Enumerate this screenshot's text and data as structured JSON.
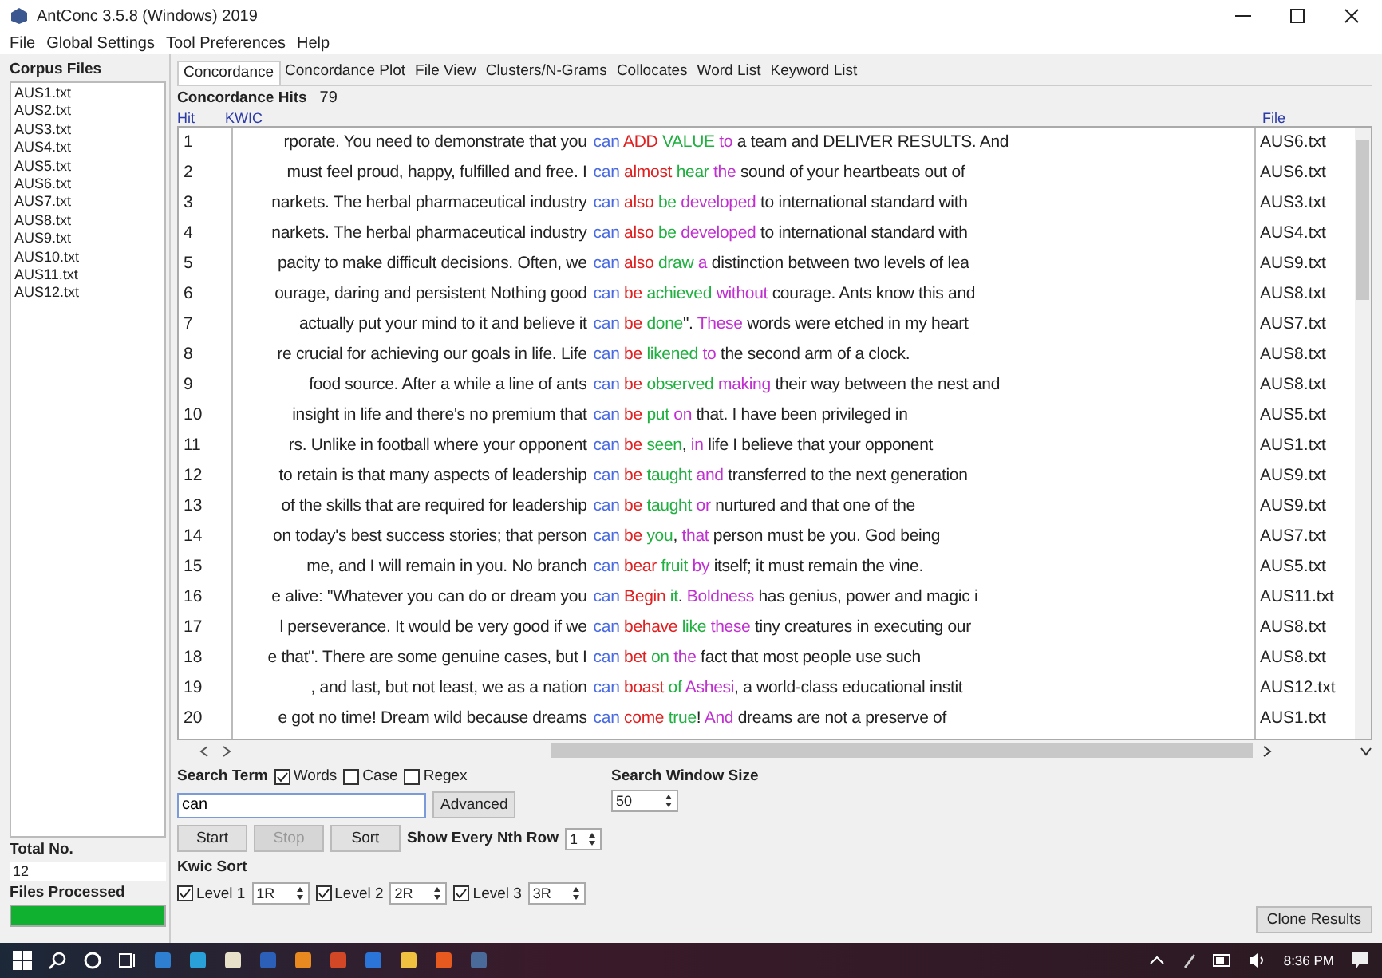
{
  "window": {
    "title": "AntConc 3.5.8 (Windows) 2019"
  },
  "menu": [
    "File",
    "Global Settings",
    "Tool Preferences",
    "Help"
  ],
  "sidebar": {
    "heading": "Corpus Files",
    "files": [
      "AUS1.txt",
      "AUS2.txt",
      "AUS3.txt",
      "AUS4.txt",
      "AUS5.txt",
      "AUS6.txt",
      "AUS7.txt",
      "AUS8.txt",
      "AUS9.txt",
      "AUS10.txt",
      "AUS11.txt",
      "AUS12.txt"
    ],
    "total_label": "Total No.",
    "total": "12",
    "processed_label": "Files Processed",
    "progress": {
      "level": 1
    }
  },
  "tabs": [
    {
      "label": "Concordance",
      "selected": true
    },
    {
      "label": "Concordance Plot",
      "selected": false
    },
    {
      "label": "File View",
      "selected": false
    },
    {
      "label": "Clusters/N-Grams",
      "selected": false
    },
    {
      "label": "Collocates",
      "selected": false
    },
    {
      "label": "Word List",
      "selected": false
    },
    {
      "label": "Keyword List",
      "selected": false
    }
  ],
  "hits": {
    "label": "Concordance Hits",
    "count": "79"
  },
  "table": {
    "columns": [
      "Hit",
      "KWIC",
      "File"
    ],
    "rows": [
      {
        "hit": "1",
        "left": "rporate.  You need to demonstrate that you",
        "right": [
          {
            "kind": "node",
            "text": "can "
          },
          {
            "kind": "r1",
            "text": "ADD "
          },
          {
            "kind": "r2",
            "text": "VALUE "
          },
          {
            "kind": "r3",
            "text": "to "
          },
          {
            "kind": "plain",
            "text": "a team and DELIVER RESULTS.  And"
          }
        ],
        "file": "AUS6.txt"
      },
      {
        "hit": "2",
        "left": "must feel proud, happy, fulfilled and free.  I",
        "right": [
          {
            "kind": "node",
            "text": "can "
          },
          {
            "kind": "r1",
            "text": "almost "
          },
          {
            "kind": "r2",
            "text": "hear "
          },
          {
            "kind": "r3",
            "text": "the "
          },
          {
            "kind": "plain",
            "text": "sound of your heartbeats out of"
          }
        ],
        "file": "AUS6.txt"
      },
      {
        "hit": "3",
        "left": "narkets. The herbal pharmaceutical industry",
        "right": [
          {
            "kind": "node",
            "text": "can "
          },
          {
            "kind": "r1",
            "text": "also "
          },
          {
            "kind": "r2",
            "text": "be "
          },
          {
            "kind": "r3",
            "text": "developed "
          },
          {
            "kind": "plain",
            "text": "to international standard with"
          }
        ],
        "file": "AUS3.txt"
      },
      {
        "hit": "4",
        "left": "narkets. The herbal pharmaceutical industry",
        "right": [
          {
            "kind": "node",
            "text": "can "
          },
          {
            "kind": "r1",
            "text": "also "
          },
          {
            "kind": "r2",
            "text": "be "
          },
          {
            "kind": "r3",
            "text": "developed "
          },
          {
            "kind": "plain",
            "text": "to international standard with"
          }
        ],
        "file": "AUS4.txt"
      },
      {
        "hit": "5",
        "left": "pacity to make difficult decisions.  Often, we",
        "right": [
          {
            "kind": "node",
            "text": "can "
          },
          {
            "kind": "r1",
            "text": "also "
          },
          {
            "kind": "r2",
            "text": "draw "
          },
          {
            "kind": "r3",
            "text": "a "
          },
          {
            "kind": "plain",
            "text": "distinction between two levels of lea"
          }
        ],
        "file": "AUS9.txt"
      },
      {
        "hit": "6",
        "left": "ourage, daring and persistent Nothing good",
        "right": [
          {
            "kind": "node",
            "text": "can "
          },
          {
            "kind": "r1",
            "text": "be "
          },
          {
            "kind": "r2",
            "text": "achieved "
          },
          {
            "kind": "r3",
            "text": "without "
          },
          {
            "kind": "plain",
            "text": "courage.  Ants know this and"
          }
        ],
        "file": "AUS8.txt"
      },
      {
        "hit": "7",
        "left": "actually put your mind to it and believe it",
        "right": [
          {
            "kind": "node",
            "text": "can "
          },
          {
            "kind": "r1",
            "text": "be "
          },
          {
            "kind": "r2",
            "text": "done"
          },
          {
            "kind": "plain",
            "text": "\".  "
          },
          {
            "kind": "r3",
            "text": "These "
          },
          {
            "kind": "plain",
            "text": "words were etched in my heart"
          }
        ],
        "file": "AUS7.txt"
      },
      {
        "hit": "8",
        "left": "re crucial for achieving our goals in life. Life",
        "right": [
          {
            "kind": "node",
            "text": "can "
          },
          {
            "kind": "r1",
            "text": "be "
          },
          {
            "kind": "r2",
            "text": "likened "
          },
          {
            "kind": "r3",
            "text": "to "
          },
          {
            "kind": "plain",
            "text": "the second arm of a clock."
          }
        ],
        "file": "AUS8.txt"
      },
      {
        "hit": "9",
        "left": "food source.  After a while a line of ants",
        "right": [
          {
            "kind": "node",
            "text": "can "
          },
          {
            "kind": "r1",
            "text": "be "
          },
          {
            "kind": "r2",
            "text": "observed "
          },
          {
            "kind": "r3",
            "text": "making "
          },
          {
            "kind": "plain",
            "text": "their way between the nest and"
          }
        ],
        "file": "AUS8.txt"
      },
      {
        "hit": "10",
        "left": "insight in life and there's no premium that",
        "right": [
          {
            "kind": "node",
            "text": "can "
          },
          {
            "kind": "r1",
            "text": "be "
          },
          {
            "kind": "r2",
            "text": "put "
          },
          {
            "kind": "r3",
            "text": "on "
          },
          {
            "kind": "plain",
            "text": "that.  I have been privileged in"
          }
        ],
        "file": "AUS5.txt"
      },
      {
        "hit": "11",
        "left": "rs.  Unlike in football where your opponent",
        "right": [
          {
            "kind": "node",
            "text": "can "
          },
          {
            "kind": "r1",
            "text": "be "
          },
          {
            "kind": "r2",
            "text": "seen"
          },
          {
            "kind": "plain",
            "text": ", "
          },
          {
            "kind": "r3",
            "text": "in "
          },
          {
            "kind": "plain",
            "text": "life I believe that your opponent"
          }
        ],
        "file": "AUS1.txt"
      },
      {
        "hit": "12",
        "left": "to retain is that many aspects of leadership",
        "right": [
          {
            "kind": "node",
            "text": "can "
          },
          {
            "kind": "r1",
            "text": "be "
          },
          {
            "kind": "r2",
            "text": "taught "
          },
          {
            "kind": "r3",
            "text": "and "
          },
          {
            "kind": "plain",
            "text": "transferred to the next generation"
          }
        ],
        "file": "AUS9.txt"
      },
      {
        "hit": "13",
        "left": "of the skills that are required for leadership",
        "right": [
          {
            "kind": "node",
            "text": "can "
          },
          {
            "kind": "r1",
            "text": "be "
          },
          {
            "kind": "r2",
            "text": "taught "
          },
          {
            "kind": "r3",
            "text": "or "
          },
          {
            "kind": "plain",
            "text": "nurtured and that one of the"
          }
        ],
        "file": "AUS9.txt"
      },
      {
        "hit": "14",
        "left": "on today's best success stories; that person",
        "right": [
          {
            "kind": "node",
            "text": "can "
          },
          {
            "kind": "r1",
            "text": "be "
          },
          {
            "kind": "r2",
            "text": "you"
          },
          {
            "kind": "plain",
            "text": ", "
          },
          {
            "kind": "r3",
            "text": "that "
          },
          {
            "kind": "plain",
            "text": "person must be you. God being"
          }
        ],
        "file": "AUS7.txt"
      },
      {
        "hit": "15",
        "left": "me, and I will remain in you.  No branch",
        "right": [
          {
            "kind": "node",
            "text": "can "
          },
          {
            "kind": "r1",
            "text": "bear "
          },
          {
            "kind": "r2",
            "text": "fruit "
          },
          {
            "kind": "r3",
            "text": "by "
          },
          {
            "kind": "plain",
            "text": "itself; it must remain the vine."
          }
        ],
        "file": "AUS5.txt"
      },
      {
        "hit": "16",
        "left": "e alive: \"Whatever you can do or dream you",
        "right": [
          {
            "kind": "node",
            "text": "can "
          },
          {
            "kind": "r1",
            "text": "Begin "
          },
          {
            "kind": "r2",
            "text": "it"
          },
          {
            "kind": "plain",
            "text": ".  "
          },
          {
            "kind": "r3",
            "text": "Boldness "
          },
          {
            "kind": "plain",
            "text": "has genius, power and magic i"
          }
        ],
        "file": "AUS11.txt"
      },
      {
        "hit": "17",
        "left": "l perseverance.  It would be very good if we",
        "right": [
          {
            "kind": "node",
            "text": "can "
          },
          {
            "kind": "r1",
            "text": "behave "
          },
          {
            "kind": "r2",
            "text": "like "
          },
          {
            "kind": "r3",
            "text": "these "
          },
          {
            "kind": "plain",
            "text": "tiny creatures in executing our"
          }
        ],
        "file": "AUS8.txt"
      },
      {
        "hit": "18",
        "left": "e that\". There are some genuine cases, but I",
        "right": [
          {
            "kind": "node",
            "text": "can "
          },
          {
            "kind": "r1",
            "text": "bet "
          },
          {
            "kind": "r2",
            "text": "on "
          },
          {
            "kind": "r3",
            "text": "the "
          },
          {
            "kind": "plain",
            "text": "fact that most people use such"
          }
        ],
        "file": "AUS8.txt"
      },
      {
        "hit": "19",
        "left": ", and last, but not least, we as a nation",
        "right": [
          {
            "kind": "node",
            "text": "can "
          },
          {
            "kind": "r1",
            "text": "boast "
          },
          {
            "kind": "r2",
            "text": "of "
          },
          {
            "kind": "r3",
            "text": "Ashesi"
          },
          {
            "kind": "plain",
            "text": ", a world-class educational instit"
          }
        ],
        "file": "AUS12.txt"
      },
      {
        "hit": "20",
        "left": "e got no time!  Dream wild because dreams",
        "right": [
          {
            "kind": "node",
            "text": "can "
          },
          {
            "kind": "r1",
            "text": "come "
          },
          {
            "kind": "r2",
            "text": "true"
          },
          {
            "kind": "plain",
            "text": "!  "
          },
          {
            "kind": "r3",
            "text": "And "
          },
          {
            "kind": "plain",
            "text": "dreams are not a preserve of"
          }
        ],
        "file": "AUS1.txt"
      }
    ]
  },
  "search": {
    "label": "Search Term",
    "options": [
      {
        "label": "Words",
        "checked": true
      },
      {
        "label": "Case",
        "checked": false
      },
      {
        "label": "Regex",
        "checked": false
      }
    ],
    "value": "can",
    "advanced": "Advanced",
    "window_size_label": "Search Window Size",
    "window_size": "50"
  },
  "buttons": [
    {
      "label": "Start",
      "disabled": false
    },
    {
      "label": "Stop",
      "disabled": true
    },
    {
      "label": "Sort",
      "disabled": false
    }
  ],
  "nth_row": {
    "label": "Show Every Nth Row",
    "value": "1"
  },
  "kwic_sort": {
    "label": "Kwic Sort",
    "levels": [
      {
        "label": "Level 1",
        "checked": true,
        "value": "1R"
      },
      {
        "label": "Level 2",
        "checked": true,
        "value": "2R"
      },
      {
        "label": "Level 3",
        "checked": true,
        "value": "3R"
      }
    ]
  },
  "clone": "Clone Results",
  "taskbar": {
    "time": "8:36 PM"
  }
}
